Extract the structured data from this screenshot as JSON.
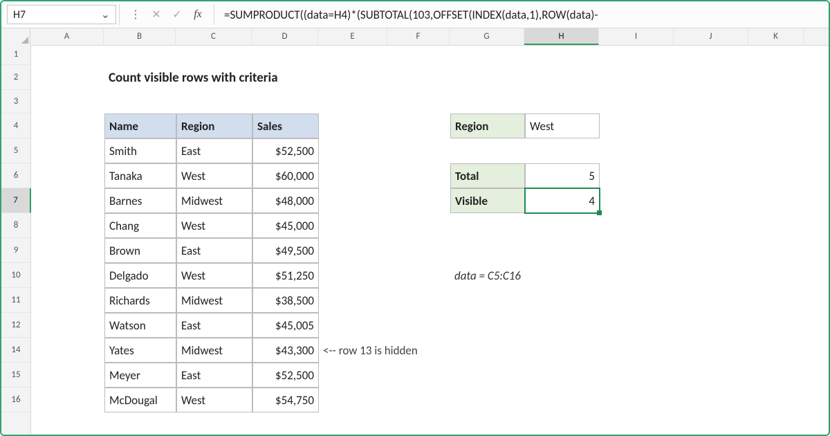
{
  "namebox": {
    "value": "H7",
    "chevron": "⌄"
  },
  "fbar_icons": {
    "dots": "⋮",
    "cancel": "✕",
    "enter": "✓",
    "fx": "fx"
  },
  "formula": "=SUMPRODUCT((data=H4)*(SUBTOTAL(103,OFFSET(INDEX(data,1),ROW(data)-",
  "colA_w": 106,
  "cols": [
    {
      "label": "A",
      "w": 106
    },
    {
      "label": "B",
      "w": 104
    },
    {
      "label": "C",
      "w": 110
    },
    {
      "label": "D",
      "w": 96
    },
    {
      "label": "E",
      "w": 100
    },
    {
      "label": "F",
      "w": 90
    },
    {
      "label": "G",
      "w": 108
    },
    {
      "label": "H",
      "w": 108,
      "sel": true
    },
    {
      "label": "I",
      "w": 108
    },
    {
      "label": "J",
      "w": 108
    },
    {
      "label": "K",
      "w": 80
    }
  ],
  "rows": [
    {
      "label": "1",
      "h": 30
    },
    {
      "label": "2",
      "h": 36
    },
    {
      "label": "3",
      "h": 34
    },
    {
      "label": "4",
      "h": 36
    },
    {
      "label": "5",
      "h": 36
    },
    {
      "label": "6",
      "h": 36
    },
    {
      "label": "7",
      "h": 36,
      "sel": true
    },
    {
      "label": "8",
      "h": 36
    },
    {
      "label": "9",
      "h": 36
    },
    {
      "label": "10",
      "h": 36
    },
    {
      "label": "11",
      "h": 36
    },
    {
      "label": "12",
      "h": 36
    },
    {
      "label": "14",
      "h": 36
    },
    {
      "label": "15",
      "h": 36
    },
    {
      "label": "16",
      "h": 36
    }
  ],
  "title": "Count visible rows with criteria",
  "table": {
    "headers": {
      "name": "Name",
      "region": "Region",
      "sales": "Sales"
    },
    "rows": [
      {
        "name": "Smith",
        "region": "East",
        "sales": "$52,500"
      },
      {
        "name": "Tanaka",
        "region": "West",
        "sales": "$60,000"
      },
      {
        "name": "Barnes",
        "region": "Midwest",
        "sales": "$48,000"
      },
      {
        "name": "Chang",
        "region": "West",
        "sales": "$45,000"
      },
      {
        "name": "Brown",
        "region": "East",
        "sales": "$49,500"
      },
      {
        "name": "Delgado",
        "region": "West",
        "sales": "$51,250"
      },
      {
        "name": "Richards",
        "region": "Midwest",
        "sales": "$38,500"
      },
      {
        "name": "Watson",
        "region": "East",
        "sales": "$45,005"
      },
      {
        "name": "Yates",
        "region": "Midwest",
        "sales": "$43,300"
      },
      {
        "name": "Meyer",
        "region": "East",
        "sales": "$52,500"
      },
      {
        "name": "McDougal",
        "region": "West",
        "sales": "$54,750"
      }
    ]
  },
  "side": {
    "region_label": "Region",
    "region_value": "West",
    "total_label": "Total",
    "total_value": "5",
    "visible_label": "Visible",
    "visible_value": "4"
  },
  "hidden_note": "<--  row 13 is hidden",
  "data_note": "data = C5:C16"
}
